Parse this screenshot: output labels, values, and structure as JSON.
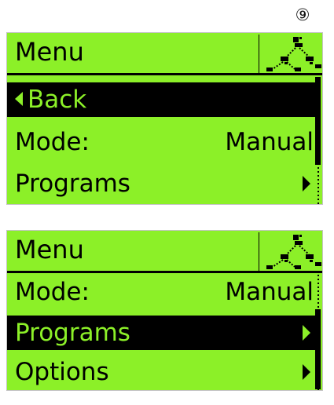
{
  "callout": {
    "label": "⑨"
  },
  "screens": [
    {
      "title": "Menu",
      "icon": "network-tree-icon",
      "items": [
        {
          "label": "Back",
          "value": "",
          "arrow": "back",
          "selected": true
        },
        {
          "label": "Mode:",
          "value": "Manual",
          "arrow": "",
          "selected": false
        },
        {
          "label": "Programs",
          "value": "",
          "arrow": "submenu",
          "selected": false
        }
      ]
    },
    {
      "title": "Menu",
      "icon": "network-tree-icon",
      "items": [
        {
          "label": "Mode:",
          "value": "Manual",
          "arrow": "",
          "selected": false
        },
        {
          "label": "Programs",
          "value": "",
          "arrow": "submenu",
          "selected": true
        },
        {
          "label": "Options",
          "value": "",
          "arrow": "submenu",
          "selected": false
        }
      ]
    }
  ],
  "colors": {
    "lcd_background": "#8cf028",
    "lcd_foreground": "#000000"
  }
}
